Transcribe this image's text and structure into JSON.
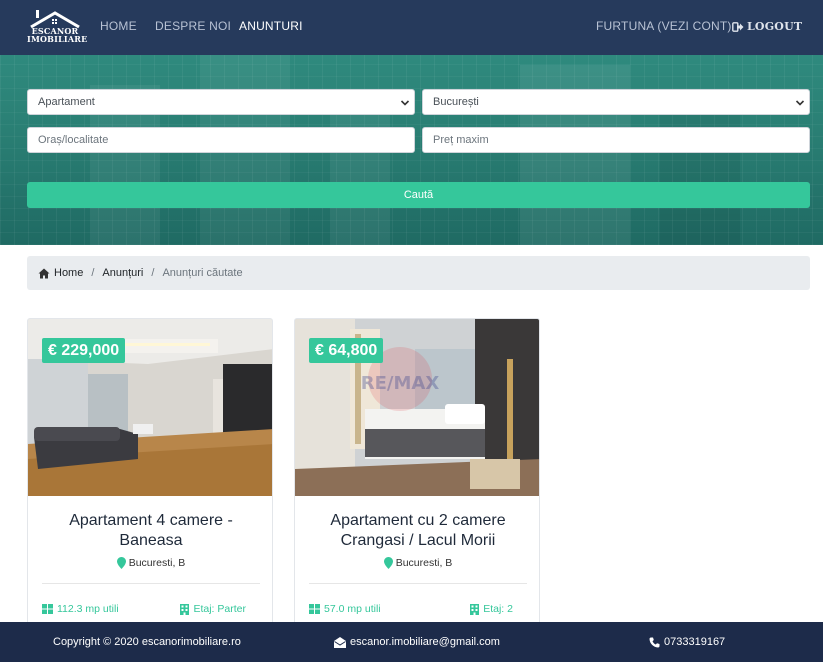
{
  "nav": {
    "logo_line1": "ESCANOR",
    "logo_line2": "IMOBILIARE",
    "home": "HOME",
    "about": "DESPRE NOI",
    "ads": "ANUNTURI",
    "account": "FURTUNA (VEZI CONT)",
    "logout": "LOGOUT"
  },
  "search": {
    "property_type": "Apartament",
    "county": "București",
    "locality_placeholder": "Oraș/localitate",
    "max_price_placeholder": "Preț maxim",
    "submit_label": "Caută"
  },
  "breadcrumb": {
    "home": "Home",
    "ads": "Anunțuri",
    "current": "Anunțuri căutate"
  },
  "listings": [
    {
      "price": "€ 229,000",
      "title": "Apartament 4 camere - Baneasa",
      "location": "Bucuresti, B",
      "area": "112.3 mp utili",
      "floor": "Etaj: Parter"
    },
    {
      "price": "€ 64,800",
      "title": "Apartament cu 2 camere Crangasi / Lacul Morii",
      "location": "Bucuresti, B",
      "area": "57.0 mp utili",
      "floor": "Etaj: 2"
    }
  ],
  "watermark": "RE/MAX",
  "footer": {
    "copyright": "Copyright © 2020 escanorimobiliare.ro",
    "email": "escanor.imobiliare@gmail.com",
    "phone": "0733319167"
  },
  "colors": {
    "navbar": "#263a5c",
    "accent": "#35c79b",
    "footer": "#1d2b4a"
  }
}
